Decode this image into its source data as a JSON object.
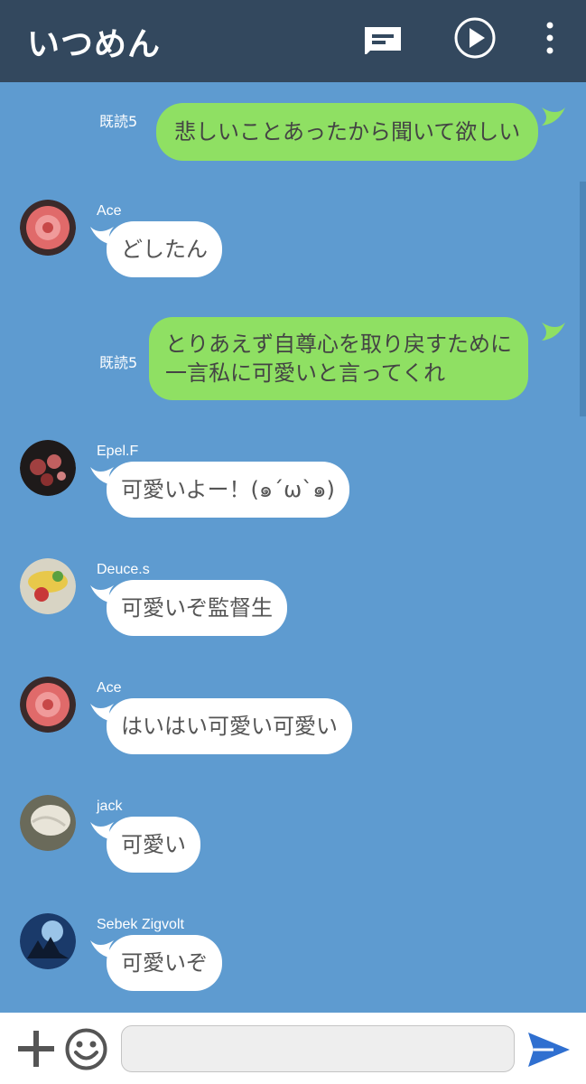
{
  "header": {
    "title": "いつめん",
    "icons": [
      "note-icon",
      "play-icon",
      "more-vertical-icon"
    ]
  },
  "messages": [
    {
      "type": "outgoing",
      "read": "既読5",
      "lines": [
        "悲しいことあったから聞いて欲しい"
      ]
    },
    {
      "type": "incoming",
      "sender": "Ace",
      "text": "どしたん"
    },
    {
      "type": "outgoing",
      "read": "既読5",
      "lines": [
        "とりあえず自尊心を取り戻すために",
        "一言私に可愛いと言ってくれ"
      ]
    },
    {
      "type": "incoming",
      "sender": "Epel.F",
      "text": "可愛いよー！(๑´ω`๑)"
    },
    {
      "type": "incoming",
      "sender": "Deuce.s",
      "text": "可愛いぞ監督生"
    },
    {
      "type": "incoming",
      "sender": "Ace",
      "text": "はいはい可愛い可愛い"
    },
    {
      "type": "incoming",
      "sender": "jack",
      "text": "可愛い"
    },
    {
      "type": "incoming",
      "sender": "Sebek Zigvolt",
      "text": "可愛いぞ"
    }
  ],
  "footer": {
    "input_value": "",
    "icons": [
      "plus-icon",
      "smile-icon",
      "send-icon"
    ]
  },
  "colors": {
    "header": "#33485e",
    "chat_bg": "#5e9bd0",
    "outgoing_bubble": "#8fe063",
    "incoming_bubble": "#ffffff",
    "send_accent": "#2f6fd0"
  }
}
